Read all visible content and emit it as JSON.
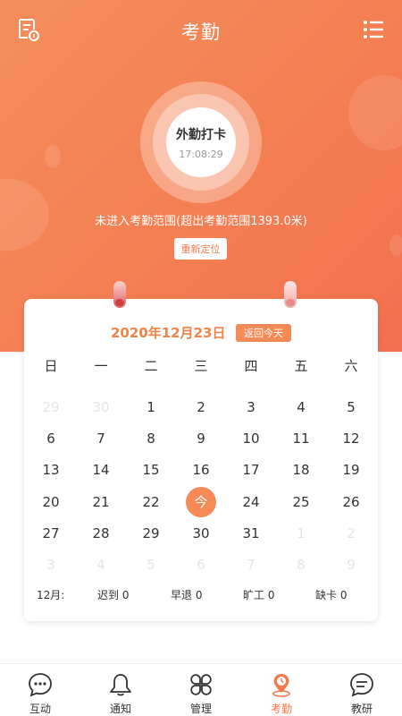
{
  "header": {
    "title": "考勤",
    "left_icon": "document-list-icon",
    "right_icon": "menu-list-icon"
  },
  "punch": {
    "label": "外勤打卡",
    "time": "17:08:29"
  },
  "range_message": "未进入考勤范围(超出考勤范围1393.0米)",
  "relocate_label": "重新定位",
  "calendar": {
    "date_title": "2020年12月23日",
    "today_button": "返回今天",
    "weekdays": [
      "日",
      "一",
      "二",
      "三",
      "四",
      "五",
      "六"
    ],
    "weeks": [
      [
        {
          "d": "29",
          "f": true
        },
        {
          "d": "30",
          "f": true
        },
        {
          "d": "1"
        },
        {
          "d": "2"
        },
        {
          "d": "3"
        },
        {
          "d": "4"
        },
        {
          "d": "5"
        }
      ],
      [
        {
          "d": "6"
        },
        {
          "d": "7"
        },
        {
          "d": "8"
        },
        {
          "d": "9"
        },
        {
          "d": "10"
        },
        {
          "d": "11"
        },
        {
          "d": "12"
        }
      ],
      [
        {
          "d": "13"
        },
        {
          "d": "14"
        },
        {
          "d": "15"
        },
        {
          "d": "16"
        },
        {
          "d": "17"
        },
        {
          "d": "18"
        },
        {
          "d": "19"
        }
      ],
      [
        {
          "d": "20"
        },
        {
          "d": "21"
        },
        {
          "d": "22"
        },
        {
          "d": "今",
          "today": true
        },
        {
          "d": "24"
        },
        {
          "d": "25"
        },
        {
          "d": "26"
        }
      ],
      [
        {
          "d": "27"
        },
        {
          "d": "28"
        },
        {
          "d": "29"
        },
        {
          "d": "30"
        },
        {
          "d": "31"
        },
        {
          "d": "1",
          "f": true
        },
        {
          "d": "2",
          "f": true
        }
      ],
      [
        {
          "d": "3",
          "f": true
        },
        {
          "d": "4",
          "f": true
        },
        {
          "d": "5",
          "f": true
        },
        {
          "d": "6",
          "f": true
        },
        {
          "d": "7",
          "f": true
        },
        {
          "d": "8",
          "f": true
        },
        {
          "d": "9",
          "f": true
        }
      ]
    ],
    "summary": {
      "month": "12月:",
      "late": "迟到  0",
      "early": "早退  0",
      "absent": "旷工  0",
      "missing": "缺卡  0"
    }
  },
  "tabs": [
    {
      "label": "互动",
      "icon": "chat-bubble-icon"
    },
    {
      "label": "通知",
      "icon": "bell-icon"
    },
    {
      "label": "管理",
      "icon": "grid-petals-icon"
    },
    {
      "label": "考勤",
      "icon": "location-clock-icon",
      "active": true
    },
    {
      "label": "教研",
      "icon": "comment-lines-icon"
    }
  ],
  "colors": {
    "accent": "#f27a4c",
    "hero_start": "#f58e5a",
    "hero_end": "#f2704f"
  }
}
